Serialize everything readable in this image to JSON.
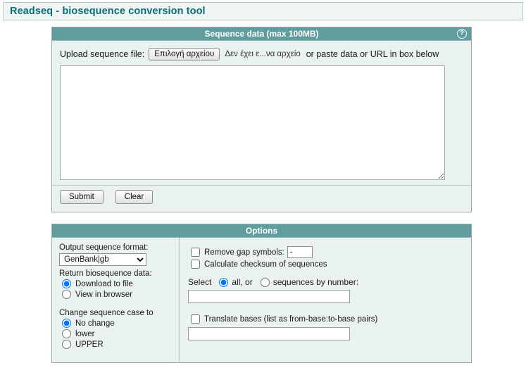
{
  "app": {
    "title": "Readseq - biosequence conversion tool"
  },
  "sequence_panel": {
    "header": "Sequence data (max 100MB)",
    "help_icon_label": "?",
    "upload_label": "Upload sequence file:",
    "file_button_label": "Επιλογή αρχείου",
    "file_status": "Δεν έχει ε...να αρχείο",
    "upload_tail": "or paste data or URL in box below",
    "textarea_value": "",
    "textarea_placeholder": "",
    "submit_label": "Submit",
    "clear_label": "Clear"
  },
  "options_panel": {
    "header": "Options",
    "left": {
      "output_format_label": "Output sequence format:",
      "output_format_value": "GenBank|gb",
      "output_format_options": [
        "GenBank|gb"
      ],
      "return_data_label": "Return biosequence data:",
      "return_options": [
        {
          "label": "Download to file",
          "selected": true
        },
        {
          "label": "View in browser",
          "selected": false
        }
      ],
      "case_label": "Change sequence case to",
      "case_options": [
        {
          "label": "No change",
          "selected": true
        },
        {
          "label": "lower",
          "selected": false
        },
        {
          "label": "UPPER",
          "selected": false
        }
      ]
    },
    "right": {
      "remove_gap_label": "Remove gap symbols:",
      "remove_gap_checked": false,
      "remove_gap_value": "-",
      "checksum_label": "Calculate checksum of sequences",
      "checksum_checked": false,
      "select_prefix": "Select",
      "select_all_label": "all, or",
      "select_all_checked": true,
      "select_by_number_label": "sequences by number:",
      "select_by_number_checked": false,
      "sequences_value": "",
      "translate_label": "Translate bases (list as from-base:to-base pairs)",
      "translate_checked": false,
      "translate_value": ""
    }
  },
  "colors": {
    "header_teal": "#5f9d9e",
    "panel_body": "#eaf2f0",
    "title_text": "#0a6b7a",
    "banner_bg": "#eef5f3"
  }
}
